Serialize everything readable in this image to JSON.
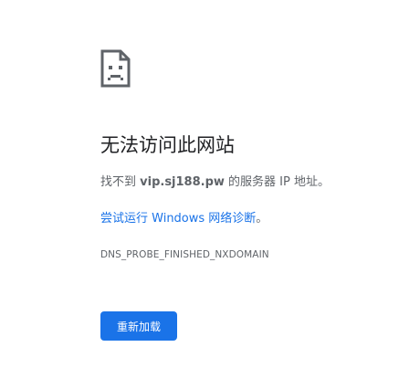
{
  "error": {
    "icon": "sad-page-icon",
    "title": "无法访问此网站",
    "message_prefix": "找不到 ",
    "host": "vip.sj188.pw",
    "message_suffix": " 的服务器 IP 地址。",
    "suggestion_link": "尝试运行 Windows 网络诊断",
    "suggestion_suffix": "。",
    "code": "DNS_PROBE_FINISHED_NXDOMAIN",
    "reload_label": "重新加载"
  },
  "colors": {
    "accent": "#1a73e8",
    "title_text": "#202124",
    "body_text": "#5f6368",
    "icon": "#5f6368"
  }
}
